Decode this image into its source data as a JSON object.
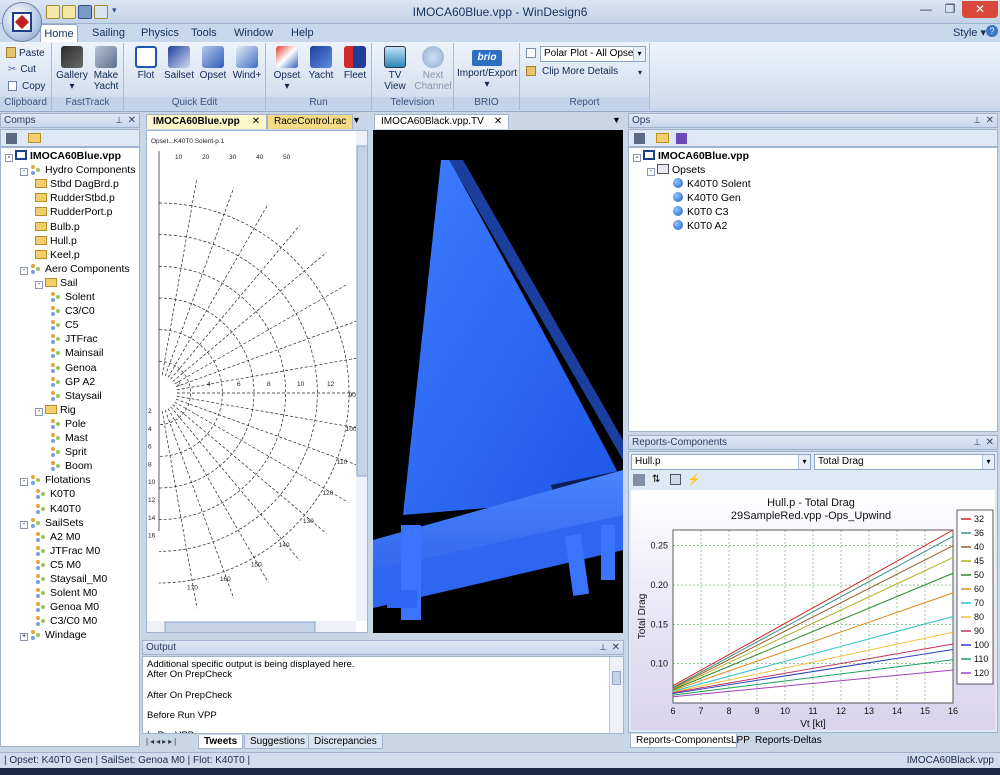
{
  "window": {
    "title": "IMOCA60Blue.vpp - WinDesign6",
    "style_label": "Style"
  },
  "menu_tabs": [
    "Home",
    "Sailing",
    "Physics",
    "Tools",
    "Window",
    "Help"
  ],
  "ribbon": {
    "clipboard": {
      "label": "Clipboard",
      "items": [
        "Paste",
        "Cut",
        "Copy"
      ]
    },
    "fasttrack": {
      "label": "FastTrack",
      "buttons": [
        "Gallery",
        "Make Yacht"
      ]
    },
    "quickedit": {
      "label": "Quick Edit",
      "buttons": [
        "Flot",
        "Sailset",
        "Opset",
        "Wind+"
      ]
    },
    "run": {
      "label": "Run",
      "buttons": [
        "Opset",
        "Yacht",
        "Fleet"
      ]
    },
    "television": {
      "label": "Television",
      "buttons": [
        "TV View",
        "Next Channel"
      ]
    },
    "brio": {
      "label": "BRIO",
      "buttons": [
        "Import/Export"
      ],
      "logo_text": "brio"
    },
    "report": {
      "label": "Report",
      "combo_value": "Polar Plot - All Opsets",
      "clip_label": "Clip More Details"
    }
  },
  "comps": {
    "title": "Comps",
    "tree": [
      {
        "label": "IMOCA60Blue.vpp",
        "level": 0,
        "type": "root",
        "bold": true,
        "exp": "-"
      },
      {
        "label": "Hydro Components",
        "level": 1,
        "type": "group",
        "exp": "-"
      },
      {
        "label": "Stbd DagBrd.p",
        "level": 2,
        "type": "folder"
      },
      {
        "label": "RudderStbd.p",
        "level": 2,
        "type": "folder"
      },
      {
        "label": "RudderPort.p",
        "level": 2,
        "type": "folder"
      },
      {
        "label": "Bulb.p",
        "level": 2,
        "type": "folder"
      },
      {
        "label": "Hull.p",
        "level": 2,
        "type": "folder"
      },
      {
        "label": "Keel.p",
        "level": 2,
        "type": "folder"
      },
      {
        "label": "Aero Components",
        "level": 1,
        "type": "group",
        "exp": "-"
      },
      {
        "label": "Sail",
        "level": 2,
        "type": "folder",
        "exp": "-"
      },
      {
        "label": "Solent",
        "level": 3,
        "type": "leaf"
      },
      {
        "label": "C3/C0",
        "level": 3,
        "type": "leaf"
      },
      {
        "label": "C5",
        "level": 3,
        "type": "leaf"
      },
      {
        "label": "JTFrac",
        "level": 3,
        "type": "leaf"
      },
      {
        "label": "Mainsail",
        "level": 3,
        "type": "leaf"
      },
      {
        "label": "Genoa",
        "level": 3,
        "type": "leaf"
      },
      {
        "label": "GP A2",
        "level": 3,
        "type": "leaf"
      },
      {
        "label": "Staysail",
        "level": 3,
        "type": "leaf"
      },
      {
        "label": "Rig",
        "level": 2,
        "type": "folder",
        "exp": "-"
      },
      {
        "label": "Pole",
        "level": 3,
        "type": "leaf"
      },
      {
        "label": "Mast",
        "level": 3,
        "type": "leaf"
      },
      {
        "label": "Sprit",
        "level": 3,
        "type": "leaf"
      },
      {
        "label": "Boom",
        "level": 3,
        "type": "leaf"
      },
      {
        "label": "Flotations",
        "level": 1,
        "type": "group",
        "exp": "-"
      },
      {
        "label": "K0T0",
        "level": 2,
        "type": "leaf"
      },
      {
        "label": "K40T0",
        "level": 2,
        "type": "leaf"
      },
      {
        "label": "SailSets",
        "level": 1,
        "type": "group",
        "exp": "-"
      },
      {
        "label": "A2 M0",
        "level": 2,
        "type": "leaf"
      },
      {
        "label": "JTFrac M0",
        "level": 2,
        "type": "leaf"
      },
      {
        "label": "C5 M0",
        "level": 2,
        "type": "leaf"
      },
      {
        "label": "Staysail_M0",
        "level": 2,
        "type": "leaf"
      },
      {
        "label": "Solent M0",
        "level": 2,
        "type": "leaf"
      },
      {
        "label": "Genoa M0",
        "level": 2,
        "type": "leaf"
      },
      {
        "label": "C3/C0 M0",
        "level": 2,
        "type": "leaf"
      },
      {
        "label": "Windage",
        "level": 1,
        "type": "group",
        "exp": "+"
      }
    ]
  },
  "doc_tabs": {
    "left": [
      "IMOCA60Blue.vpp",
      "RaceControl.rac"
    ],
    "right": [
      "IMOCA60Black.vpp.TV"
    ]
  },
  "polar": {
    "caption": "Opset...K40T0 Solent-p.1",
    "top_labels": [
      "10",
      "20",
      "30",
      "40",
      "50"
    ],
    "radial_labels": [
      "2",
      "4",
      "6",
      "8",
      "10",
      "12"
    ],
    "right_labels": [
      "90",
      "100",
      "110",
      "120",
      "130",
      "140",
      "150",
      "160",
      "170"
    ],
    "left_labels": [
      "2",
      "4",
      "6",
      "8",
      "10",
      "12",
      "14",
      "16"
    ]
  },
  "ops": {
    "title": "Ops",
    "root": "IMOCA60Blue.vpp",
    "group": "Opsets",
    "items": [
      "K40T0 Solent",
      "K40T0 Gen",
      "K0T0 C3",
      "K0T0 A2"
    ]
  },
  "output": {
    "title": "Output",
    "lines": [
      "Additional specific output is being displayed here.",
      "After On PrepCheck",
      "",
      "After On PrepCheck",
      "",
      "Before Run VPP",
      "",
      "In RunVPP"
    ],
    "tabs": [
      "Tweets",
      "Suggestions",
      "Discrepancies"
    ]
  },
  "reports": {
    "title": "Reports-Components",
    "combo_left": "Hull.p",
    "combo_right": "Total Drag",
    "tabs": [
      "Reports-Components",
      "LPP",
      "Reports-Deltas"
    ]
  },
  "status": {
    "left": "| Opset: K40T0 Gen | SailSet: Genoa M0 | Flot: K40T0 |",
    "right": "IMOCA60Black.vpp"
  },
  "chart_data": {
    "type": "line",
    "title": "Hull.p - Total Drag",
    "subtitle": "29SampleRed.vpp -Ops_Upwind",
    "xlabel": "Vt [kt]",
    "ylabel": "Total Drag",
    "xlim": [
      6,
      16
    ],
    "ylim": [
      0.05,
      0.27
    ],
    "x_ticks": [
      6,
      7,
      8,
      9,
      10,
      11,
      12,
      13,
      14,
      15,
      16
    ],
    "y_ticks": [
      0.1,
      0.15,
      0.2,
      0.25
    ],
    "y_tick_labels": [
      "0.10",
      "0.15",
      "0.20",
      "0.25"
    ],
    "grid": true,
    "legend_position": "right",
    "x": [
      6,
      16
    ],
    "series": [
      {
        "name": "32",
        "color": "#d42020",
        "values": [
          0.072,
          0.27
        ]
      },
      {
        "name": "36",
        "color": "#3a8c8c",
        "values": [
          0.07,
          0.262
        ]
      },
      {
        "name": "40",
        "color": "#9a5a2a",
        "values": [
          0.069,
          0.25
        ]
      },
      {
        "name": "45",
        "color": "#b0b020",
        "values": [
          0.068,
          0.235
        ]
      },
      {
        "name": "50",
        "color": "#2a8a2a",
        "values": [
          0.067,
          0.215
        ]
      },
      {
        "name": "60",
        "color": "#e08c20",
        "values": [
          0.066,
          0.19
        ]
      },
      {
        "name": "70",
        "color": "#30c0c0",
        "values": [
          0.065,
          0.16
        ]
      },
      {
        "name": "80",
        "color": "#f0c040",
        "values": [
          0.064,
          0.14
        ]
      },
      {
        "name": "90",
        "color": "#c03060",
        "values": [
          0.063,
          0.125
        ]
      },
      {
        "name": "100",
        "color": "#3040c0",
        "values": [
          0.062,
          0.118
        ]
      },
      {
        "name": "110",
        "color": "#20a060",
        "values": [
          0.06,
          0.105
        ]
      },
      {
        "name": "120",
        "color": "#a040c0",
        "values": [
          0.058,
          0.092
        ]
      }
    ]
  }
}
